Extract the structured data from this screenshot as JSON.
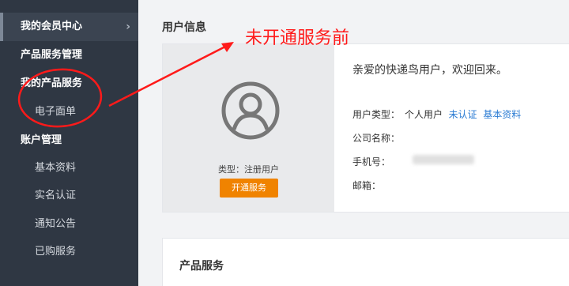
{
  "sidebar": {
    "items": [
      {
        "label": "我的会员中心"
      },
      {
        "label": "产品服务管理"
      },
      {
        "label": "我的产品服务"
      },
      {
        "label": "电子面单"
      },
      {
        "label": "账户管理"
      },
      {
        "label": "基本资料"
      },
      {
        "label": "实名认证"
      },
      {
        "label": "通知公告"
      },
      {
        "label": "已购服务"
      }
    ],
    "chevron": "›"
  },
  "main": {
    "section_title": "用户信息",
    "annotation": "未开通服务前",
    "user_card": {
      "type_label": "类型：注册用户",
      "open_button": "开通服务",
      "welcome": "亲爱的快递鸟用户，欢迎回来。",
      "user_type_label": "用户类型：",
      "user_type_value": "个人用户",
      "unverified_link": "未认证",
      "profile_link": "基本资料",
      "company_label": "公司名称：",
      "phone_label": "手机号：",
      "email_label": "邮箱："
    },
    "product_title": "产品服务"
  },
  "colors": {
    "sidebar_bg": "#2f3743",
    "accent_orange": "#f08300",
    "link_blue": "#2a7bd3",
    "annotation_red": "#ff1a1a"
  },
  "icons": [
    "chevron-right-icon",
    "user-avatar-icon"
  ]
}
